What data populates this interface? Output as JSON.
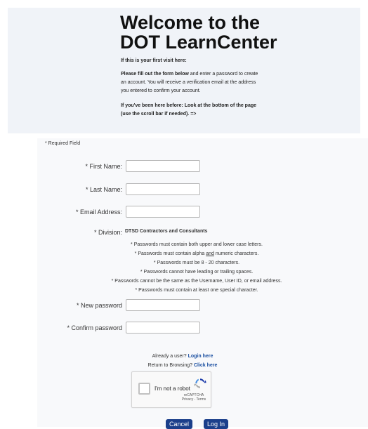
{
  "header": {
    "title_line1": "Welcome to the",
    "title_line2": "DOT LearnCenter",
    "first_visit": "If this is your first visit here:",
    "instructions_bold": "Please fill out the form below",
    "instructions_rest_1": " and enter a password to create",
    "instructions_line2": "an account. You will receive a verification email at the address",
    "instructions_line3": "you entered to confirm your account.",
    "returning_line1": "If you've been here before: Look at the bottom of the page",
    "returning_line2": "(use the scroll bar if needed). =>"
  },
  "form": {
    "required_note": "* Required Field",
    "first_name_label": "* First Name:",
    "first_name_value": "",
    "last_name_label": "* Last Name:",
    "last_name_value": "",
    "email_label": "* Email Address:",
    "email_value": "",
    "division_label": "* Division:",
    "division_value": "DTSD Contractors and Consultants",
    "password_rules": {
      "rule1": "* Passwords must contain both upper and lower case letters.",
      "rule2_pre": "* Passwords must contain alpha ",
      "rule2_u": "and",
      "rule2_post": " numeric characters.",
      "rule3": "* Passwords must be 8 - 20 characters.",
      "rule4": "* Passwords cannot have leading or trailing spaces.",
      "rule5": "* Passwords cannot be the same as the Username, User ID, or email address.",
      "rule6": "* Passwords must contain at least one special character."
    },
    "new_password_label": "* New password",
    "confirm_password_label": "* Confirm password"
  },
  "links": {
    "already_user_text": "Already a user?",
    "login_here": "Login here",
    "return_text": "Return to Browsing?",
    "click_here": "Click here"
  },
  "captcha": {
    "label": "I'm not a robot",
    "brand": "reCAPTCHA",
    "terms": "Privacy - Terms"
  },
  "buttons": {
    "cancel": "Cancel",
    "login": "Log In"
  },
  "colors": {
    "header_bg": "#f0f3f8",
    "button_bg": "#1b3f8b",
    "link": "#1a4fa0"
  }
}
